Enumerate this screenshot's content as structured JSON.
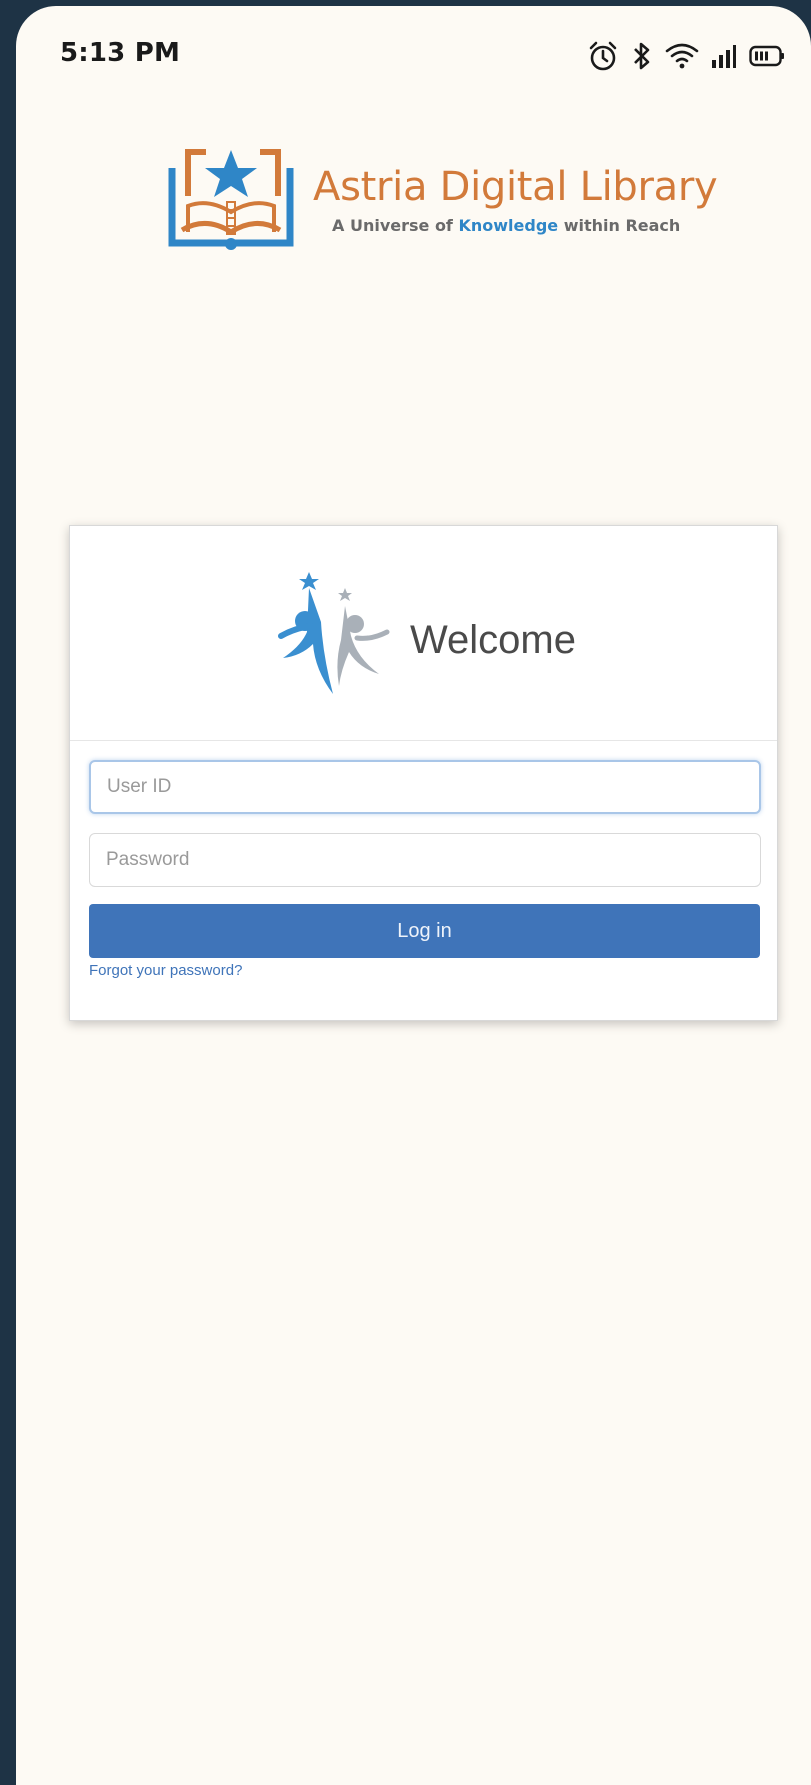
{
  "status_bar": {
    "time": "5:13 PM",
    "icons": [
      "alarm-icon",
      "bluetooth-icon",
      "wifi-icon",
      "signal-icon",
      "battery-icon"
    ]
  },
  "brand": {
    "name": "Astria Digital Library",
    "tagline_prefix": "A Universe of ",
    "tagline_highlight": "Knowledge",
    "tagline_suffix": " within Reach",
    "colors": {
      "primary": "#d27a3a",
      "secondary": "#2f86c7"
    }
  },
  "login_card": {
    "heading": "Welcome",
    "user_id_placeholder": "User ID",
    "password_placeholder": "Password",
    "login_label": "Log in",
    "forgot_password_label": "Forgot your password?",
    "colors": {
      "button": "#3f74b9"
    }
  }
}
